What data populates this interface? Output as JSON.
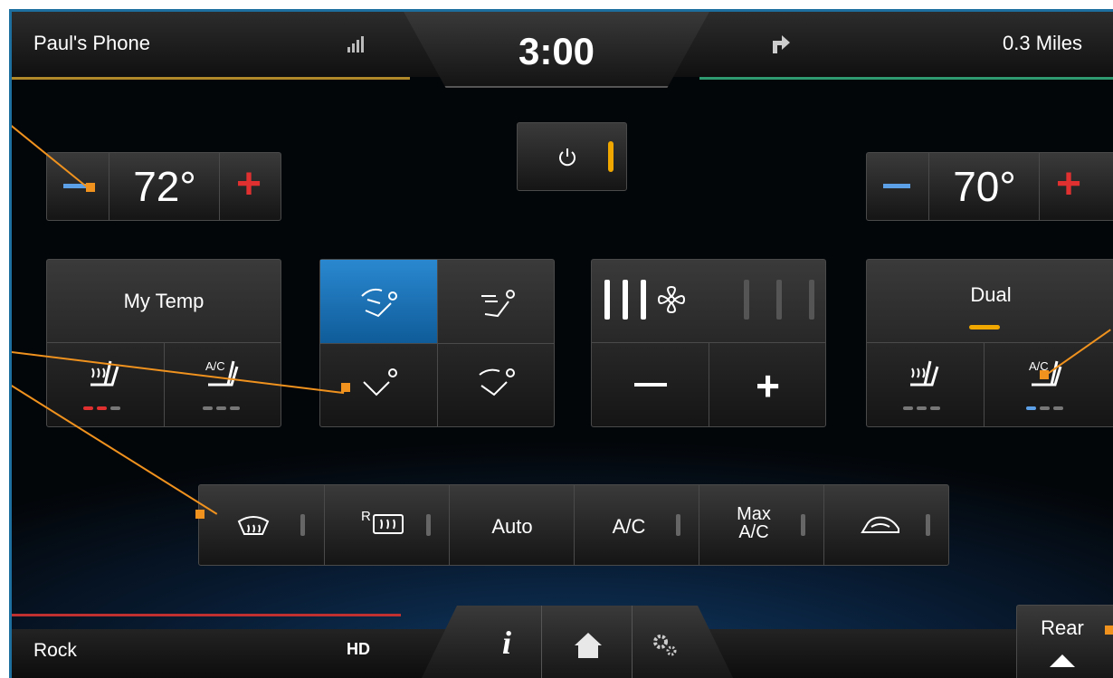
{
  "status_bar": {
    "phone": "Paul's Phone",
    "time": "3:00",
    "distance": "0.3 Miles"
  },
  "driver": {
    "temp": "72°",
    "minus": "−",
    "plus": "+"
  },
  "passenger": {
    "temp": "70°",
    "minus": "−",
    "plus": "+"
  },
  "power": {
    "icon": "power-icon"
  },
  "left_panel": {
    "my_temp": "My Temp",
    "heat_seat_icon": "heated-seat-icon",
    "ac_seat_icon": "cooled-seat-icon"
  },
  "airflow": {
    "icons": [
      "windshield-face-airflow-icon",
      "face-airflow-icon",
      "floor-airflow-icon",
      "windshield-floor-airflow-icon"
    ]
  },
  "fan": {
    "minus": "−",
    "plus": "+",
    "icon": "fan-icon",
    "level": 3,
    "max": 6
  },
  "right_panel": {
    "dual": "Dual",
    "heat_seat_icon": "heated-seat-icon",
    "ac_seat_icon": "cooled-seat-icon"
  },
  "bottom_row": {
    "front_defrost": "front-defrost-icon",
    "rear_defrost_prefix": "R",
    "auto": "Auto",
    "ac": "A/C",
    "max_ac_line1": "Max",
    "max_ac_line2": "A/C",
    "recirc": "recirculation-icon"
  },
  "footer": {
    "source": "Rock",
    "hd": "HD",
    "info": "i",
    "rear": "Rear"
  },
  "colors": {
    "callout": "#f0921e",
    "hot": "#e0302f",
    "cold": "#5ca0e8",
    "selected": "#1a6fb5"
  }
}
